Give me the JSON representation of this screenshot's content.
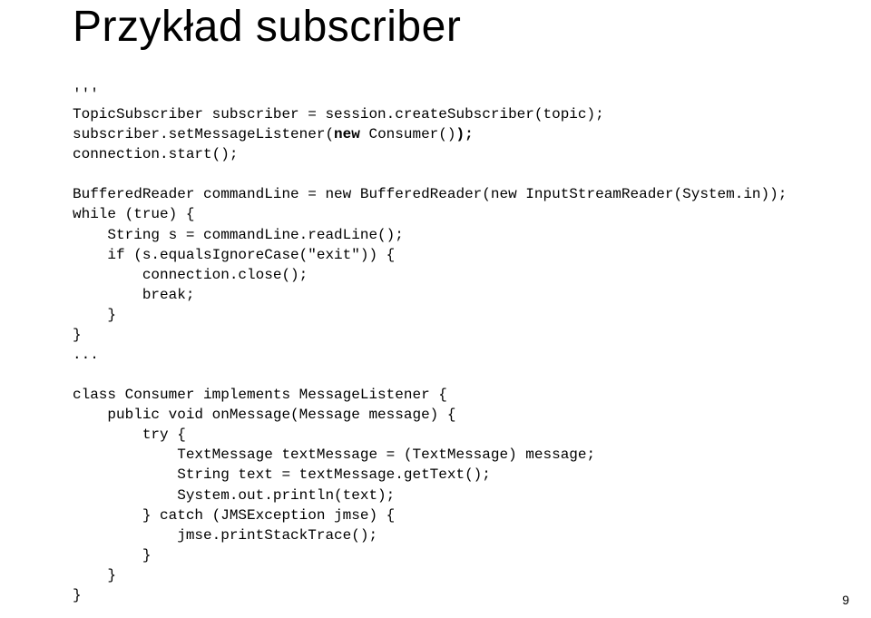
{
  "title": "Przykład subscriber",
  "code": {
    "l01": "'''",
    "l02": "TopicSubscriber subscriber = session.createSubscriber(topic);",
    "l03a": "subscriber.setMessageListener(",
    "l03kw": "new",
    "l03b": " Consumer()",
    "l03c": ");",
    "l04": "connection.start();",
    "l05": "",
    "l06": "BufferedReader commandLine = new BufferedReader(new InputStreamReader(System.in));",
    "l07": "while (true) {",
    "l08": "    String s = commandLine.readLine();",
    "l09": "    if (s.equalsIgnoreCase(\"exit\")) {",
    "l10": "        connection.close();",
    "l11": "        break;",
    "l12": "    }",
    "l13": "}",
    "l14": "...",
    "l15": "",
    "l16": "class Consumer implements MessageListener {",
    "l17": "    public void onMessage(Message message) {",
    "l18": "        try {",
    "l19": "            TextMessage textMessage = (TextMessage) message;",
    "l20": "            String text = textMessage.getText();",
    "l21": "            System.out.println(text);",
    "l22": "        } catch (JMSException jmse) {",
    "l23": "            jmse.printStackTrace();",
    "l24": "        }",
    "l25": "    }",
    "l26": "}"
  },
  "page_number": "9"
}
